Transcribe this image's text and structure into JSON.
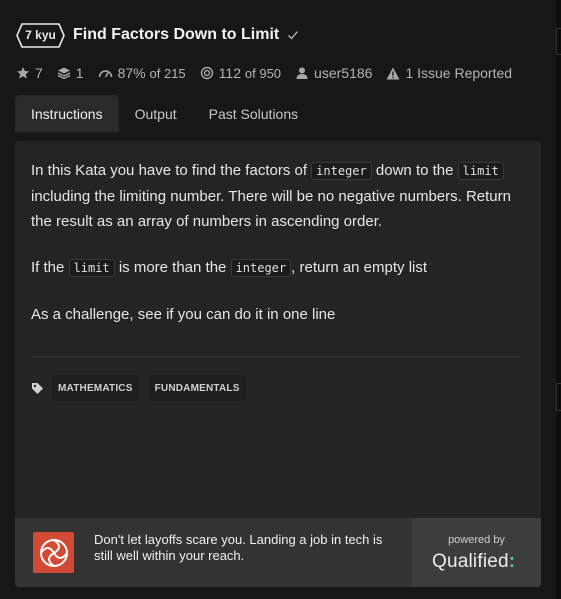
{
  "kata": {
    "rank": "7 kyu",
    "title": "Find Factors Down to Limit",
    "stats": {
      "stars": "7",
      "collections": "1",
      "satisfaction": "87%",
      "satisfaction_of": "of 215",
      "completed": "112",
      "completed_of": "of 950",
      "author": "user5186",
      "issues": "1 Issue Reported"
    }
  },
  "tabs": [
    {
      "label": "Instructions",
      "active": true
    },
    {
      "label": "Output",
      "active": false
    },
    {
      "label": "Past Solutions",
      "active": false
    }
  ],
  "description": {
    "p1_a": "In this Kata you have to find the factors of ",
    "p1_code1": "integer",
    "p1_b": " down to the ",
    "p1_code2": "limit",
    "p1_c": " including the limiting number. There will be no negative numbers. Return the result as an array of numbers in ascending order.",
    "p2_a": "If the ",
    "p2_code1": "limit",
    "p2_b": " is more than the ",
    "p2_code2": "integer",
    "p2_c": ", return an empty list",
    "p3": "As a challenge, see if you can do it in one line"
  },
  "tags": [
    "MATHEMATICS",
    "FUNDAMENTALS"
  ],
  "ad": {
    "text": "Don't let layoffs scare you. Landing a job in tech is still well within your reach.",
    "powered_by": "powered by",
    "brand": "Qualified",
    "brand_mark": ":"
  },
  "colors": {
    "background": "#171717",
    "panel": "#242424",
    "ad_logo": "#d24a34",
    "brand_accent": "#4fd1a5"
  }
}
